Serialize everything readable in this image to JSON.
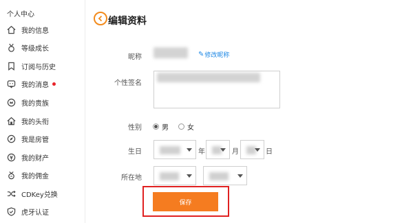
{
  "sidebar": {
    "title": "个人中心",
    "items": [
      {
        "label": "我的信息",
        "icon": "home-icon"
      },
      {
        "label": "等级成长",
        "icon": "medal-icon"
      },
      {
        "label": "订阅与历史",
        "icon": "bookmark-icon"
      },
      {
        "label": "我的消息",
        "icon": "message-icon",
        "badge": "red-dot"
      },
      {
        "label": "我的贵族",
        "icon": "noble-icon"
      },
      {
        "label": "我的头衔",
        "icon": "house-title-icon"
      },
      {
        "label": "我是房管",
        "icon": "compass-icon"
      },
      {
        "label": "我的财产",
        "icon": "coin-icon"
      },
      {
        "label": "我的佣金",
        "icon": "commission-icon"
      },
      {
        "label": "CDKey兑换",
        "icon": "shuffle-icon"
      },
      {
        "label": "虎牙认证",
        "icon": "shield-icon"
      }
    ]
  },
  "header": {
    "title": "编辑资料",
    "back_icon": "back-arrow-icon"
  },
  "form": {
    "nickname_label": "昵称",
    "edit_nickname_link": "修改昵称",
    "signature_label": "个性签名",
    "gender_label": "性别",
    "gender_options": [
      "男",
      "女"
    ],
    "gender_selected": "男",
    "birthday_label": "生日",
    "year_unit": "年",
    "month_unit": "月",
    "day_unit": "日",
    "location_label": "所在地",
    "save_label": "保存"
  },
  "colors": {
    "accent": "#f57c20",
    "link": "#1e88e5",
    "highlight_frame": "#e02020",
    "badge": "#e8242a"
  }
}
